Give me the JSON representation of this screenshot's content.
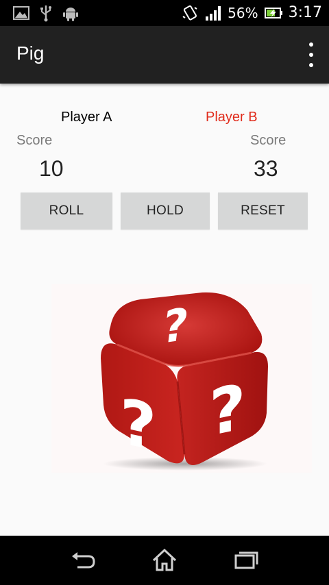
{
  "status_bar": {
    "battery_percent": "56%",
    "time": "3:17",
    "icons": [
      "gallery-icon",
      "usb-icon",
      "android-icon",
      "vibrate-icon",
      "signal-icon",
      "battery-charging-icon"
    ]
  },
  "action_bar": {
    "title": "Pig",
    "overflow_icon": "overflow-menu-icon"
  },
  "players": {
    "a": {
      "name": "Player A",
      "score_label": "Score",
      "score": "10",
      "color": "#000000"
    },
    "b": {
      "name": "Player B",
      "score_label": "Score",
      "score": "33",
      "color": "#e02b1b"
    }
  },
  "buttons": {
    "roll": "ROLL",
    "hold": "HOLD",
    "reset": "RESET"
  },
  "dice": {
    "icon": "question-dice-icon",
    "face_symbol": "?"
  },
  "nav_bar": {
    "icons": [
      "back-icon",
      "home-icon",
      "recent-apps-icon"
    ]
  }
}
